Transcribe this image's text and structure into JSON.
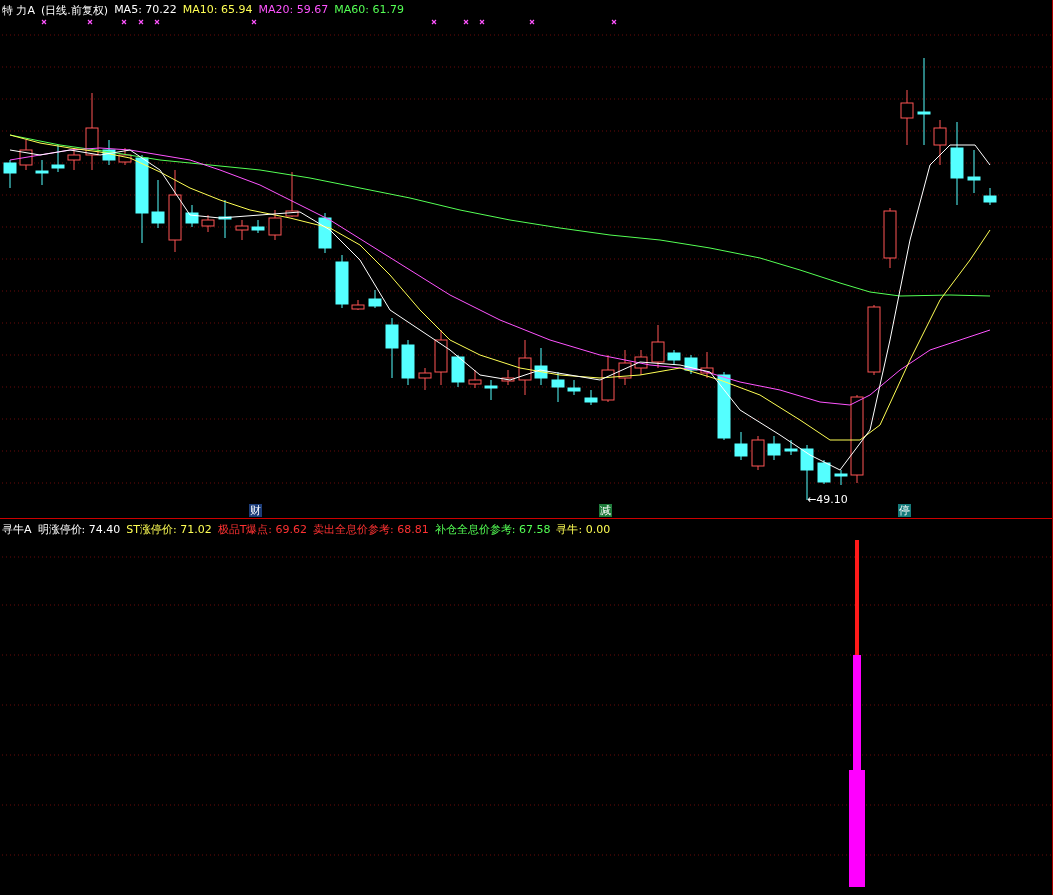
{
  "main_chart": {
    "stock_name": "特  力A",
    "period": "(日线.前复权)",
    "indicators": [
      {
        "label": "MA5: 70.22",
        "color": "#ffffff"
      },
      {
        "label": "MA10: 65.94",
        "color": "#ffff54"
      },
      {
        "label": "MA20: 59.67",
        "color": "#ff54ff"
      },
      {
        "label": "MA60: 61.79",
        "color": "#54ff54"
      }
    ],
    "low_label": "←49.10",
    "event_markers": [
      {
        "label": "财",
        "color": "#1c3c78"
      },
      {
        "label": "减",
        "color": "#1e7a3a"
      },
      {
        "label": "停",
        "color": "#157a7a"
      }
    ]
  },
  "sub_chart": {
    "title": "寻牛A",
    "indicators": [
      {
        "label": "明涨停价: 74.40",
        "color": "#ffffff"
      },
      {
        "label": "ST涨停价: 71.02",
        "color": "#ffff54"
      },
      {
        "label": "极品T爆点: 69.62",
        "color": "#ff3232"
      },
      {
        "label": "卖出全息价参考: 68.81",
        "color": "#ff3232"
      },
      {
        "label": "补仓全息价参考: 67.58",
        "color": "#54ff54"
      },
      {
        "label": "寻牛: 0.00",
        "color": "#ffff54"
      }
    ]
  }
}
